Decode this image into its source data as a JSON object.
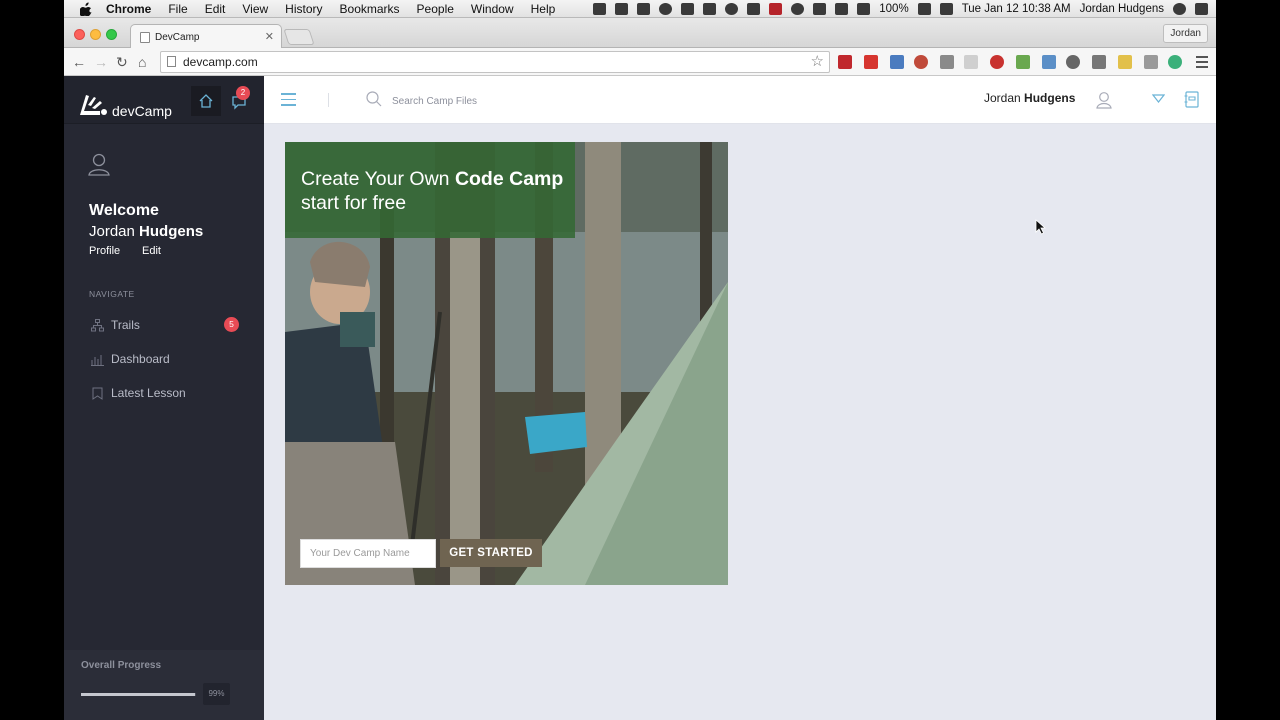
{
  "menubar": {
    "app": "Chrome",
    "items": [
      "File",
      "Edit",
      "View",
      "History",
      "Bookmarks",
      "People",
      "Window",
      "Help"
    ],
    "battery": "100%",
    "clock": "Tue Jan 12  10:38 AM",
    "user": "Jordan Hudgens"
  },
  "browser": {
    "tab_title": "DevCamp",
    "profile": "Jordan",
    "url": "devcamp.com"
  },
  "sidebar": {
    "logo_text": "devCamp",
    "notification_count": "2",
    "welcome": "Welcome",
    "first_name": "Jordan",
    "last_name": "Hudgens",
    "profile_link": "Profile",
    "edit_link": "Edit",
    "nav_heading": "NAVIGATE",
    "items": [
      {
        "label": "Trails",
        "icon": "sitemap-icon",
        "badge": "5"
      },
      {
        "label": "Dashboard",
        "icon": "bar-chart-icon"
      },
      {
        "label": "Latest Lesson",
        "icon": "bookmark-icon"
      }
    ],
    "progress_title": "Overall Progress",
    "progress_value": "99%",
    "progress_fraction": 0.99
  },
  "topbar": {
    "search_placeholder": "Search Camp Files",
    "user_first": "Jordan",
    "user_last": "Hudgens"
  },
  "hero": {
    "line1_prefix": "Create Your Own ",
    "line1_bold": "Code Camp",
    "line2": "start for free",
    "input_placeholder": "Your Dev Camp Name",
    "button_label": "GET STARTED"
  },
  "colors": {
    "sidebar_bg": "#262833",
    "main_bg": "#e6e8f0",
    "accent_blue": "#6bb3d6",
    "badge_red": "#e84b55",
    "hero_green": "#346934",
    "button_brown": "#6f6451"
  }
}
